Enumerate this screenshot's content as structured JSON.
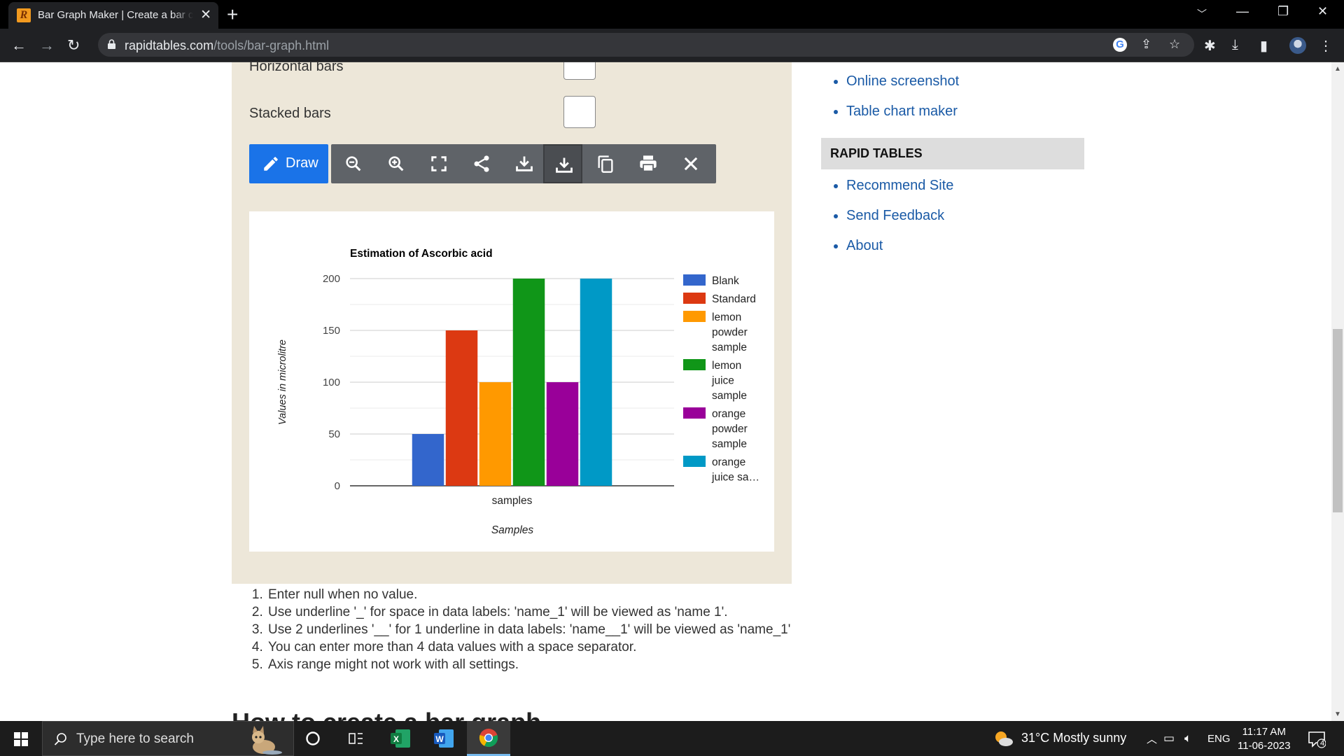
{
  "browser": {
    "tab_title": "Bar Graph Maker | Create a bar chart online",
    "url_host": "rapidtables.com",
    "url_path": "/tools/bar-graph.html",
    "icons": [
      "back-icon",
      "forward-icon",
      "reload-icon",
      "lock-icon",
      "google-icon",
      "share-icon",
      "star-icon",
      "extensions-icon",
      "download-icon",
      "sidepanel-icon",
      "menu-icon"
    ]
  },
  "options": {
    "horizontal_label": "Horizontal bars",
    "stacked_label": "Stacked bars"
  },
  "toolbar": {
    "draw_label": "Draw",
    "buttons": [
      "zoom-out",
      "zoom-in",
      "fullscreen",
      "share",
      "download-image",
      "download-file",
      "copy",
      "print",
      "close"
    ]
  },
  "chart_data": {
    "type": "bar",
    "title": "Estimation of Ascorbic acid",
    "xlabel": "Samples",
    "ylabel": "Values in microlitre",
    "categories": [
      "samples"
    ],
    "ylim": [
      0,
      200
    ],
    "yticks": [
      "0",
      "50",
      "100",
      "150",
      "200"
    ],
    "legend_position": "right",
    "series": [
      {
        "name": "Blank",
        "values": [
          50
        ],
        "color": "#3366cc"
      },
      {
        "name": "Standard",
        "values": [
          150
        ],
        "color": "#dc3912"
      },
      {
        "name": "lemon powder sample",
        "values": [
          100
        ],
        "color": "#ff9900"
      },
      {
        "name": "lemon juice sample",
        "values": [
          200
        ],
        "color": "#109618"
      },
      {
        "name": "orange powder sample",
        "values": [
          100
        ],
        "color": "#990099"
      },
      {
        "name": "orange juice sample",
        "values": [
          200
        ],
        "color": "#0099c6"
      }
    ],
    "legend_lines": [
      [
        "Blank"
      ],
      [
        "Standard"
      ],
      [
        "lemon",
        "powder",
        "sample"
      ],
      [
        "lemon",
        "juice",
        "sample"
      ],
      [
        "orange",
        "powder",
        "sample"
      ],
      [
        "orange",
        "juice sa…"
      ]
    ]
  },
  "notes": [
    "Enter null when no value.",
    "Use underline '_' for space in data labels: 'name_1' will be viewed as 'name 1'.",
    "Use 2 underlines '__' for 1 underline in data labels: 'name__1' will be viewed as 'name_1'",
    "You can enter more than 4 data values with a space separator.",
    "Axis range might not work with all settings."
  ],
  "next_heading": "How to create a bar graph",
  "sidebar": {
    "links_top": [
      "Online screenshot",
      "Table chart maker"
    ],
    "section_title": "RAPID TABLES",
    "links_bottom": [
      "Recommend Site",
      "Send Feedback",
      "About"
    ]
  },
  "taskbar": {
    "search_placeholder": "Type here to search",
    "weather": "31°C  Mostly sunny",
    "lang": "ENG",
    "time": "11:17 AM",
    "date": "11-06-2023",
    "notifications": "4"
  }
}
